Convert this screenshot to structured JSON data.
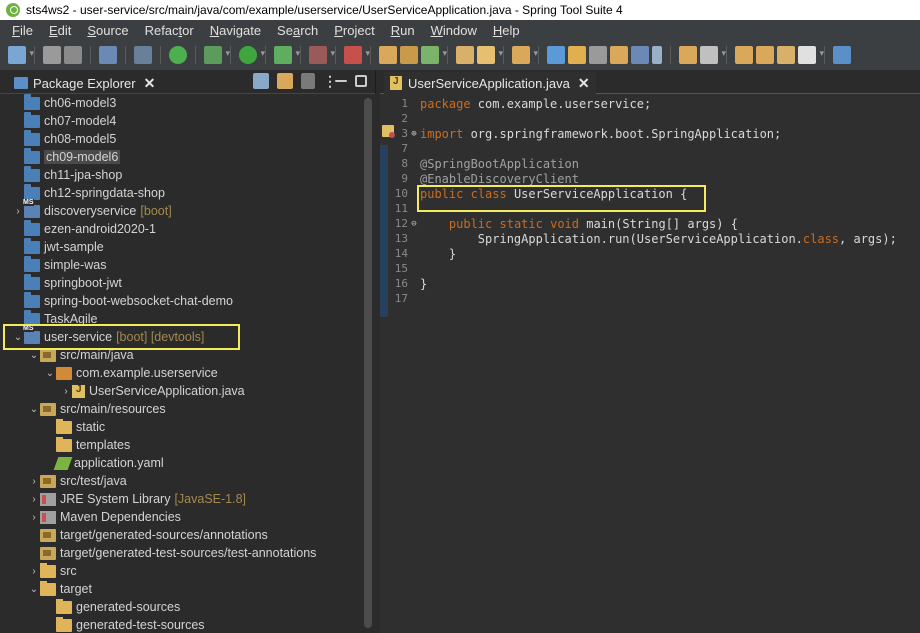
{
  "window": {
    "title": "sts4ws2 - user-service/src/main/java/com/example/userservice/UserServiceApplication.java - Spring Tool Suite 4"
  },
  "menubar": {
    "items": [
      {
        "label": "File",
        "mnemonic": "F"
      },
      {
        "label": "Edit",
        "mnemonic": "E"
      },
      {
        "label": "Source",
        "mnemonic": "S"
      },
      {
        "label": "Refactor",
        "mnemonic": "t"
      },
      {
        "label": "Navigate",
        "mnemonic": "N"
      },
      {
        "label": "Search",
        "mnemonic": "a"
      },
      {
        "label": "Project",
        "mnemonic": "P"
      },
      {
        "label": "Run",
        "mnemonic": "R"
      },
      {
        "label": "Window",
        "mnemonic": "W"
      },
      {
        "label": "Help",
        "mnemonic": "H"
      }
    ]
  },
  "package_explorer": {
    "tab_label": "Package Explorer",
    "close_glyph": "✕",
    "menu_glyph": "⋮",
    "items": [
      {
        "label": "ch06-model3",
        "suffix": "",
        "icon": "project-icon",
        "arrow": ""
      },
      {
        "label": "ch07-model4",
        "suffix": "",
        "icon": "project-icon",
        "arrow": ""
      },
      {
        "label": "ch08-model5",
        "suffix": "",
        "icon": "project-icon",
        "arrow": ""
      },
      {
        "label": "ch09-model6",
        "suffix": "",
        "icon": "project-icon",
        "arrow": ""
      },
      {
        "label": "ch11-jpa-shop",
        "suffix": "",
        "icon": "project-icon",
        "arrow": ""
      },
      {
        "label": "ch12-springdata-shop",
        "suffix": "",
        "icon": "project-icon",
        "arrow": ""
      },
      {
        "label": "discoveryservice",
        "suffix": "[boot]",
        "icon": "boot-project-icon",
        "arrow": "›"
      },
      {
        "label": "ezen-android2020-1",
        "suffix": "",
        "icon": "project-icon",
        "arrow": ""
      },
      {
        "label": "jwt-sample",
        "suffix": "",
        "icon": "project-icon",
        "arrow": ""
      },
      {
        "label": "simple-was",
        "suffix": "",
        "icon": "project-icon",
        "arrow": ""
      },
      {
        "label": "springboot-jwt",
        "suffix": "",
        "icon": "project-icon",
        "arrow": ""
      },
      {
        "label": "spring-boot-websocket-chat-demo",
        "suffix": "",
        "icon": "project-icon",
        "arrow": ""
      },
      {
        "label": "TaskAgile",
        "suffix": "",
        "icon": "project-icon",
        "arrow": ""
      },
      {
        "label": "user-service",
        "suffix": "[boot] [devtools]",
        "icon": "boot-project-icon",
        "arrow": "⌄"
      },
      {
        "label": "src/main/java",
        "suffix": "",
        "icon": "source-folder-icon",
        "arrow": "⌄"
      },
      {
        "label": "com.example.userservice",
        "suffix": "",
        "icon": "package-icon",
        "arrow": "⌄"
      },
      {
        "label": "UserServiceApplication.java",
        "suffix": "",
        "icon": "java-file-icon",
        "arrow": "›"
      },
      {
        "label": "src/main/resources",
        "suffix": "",
        "icon": "source-folder-icon",
        "arrow": "⌄"
      },
      {
        "label": "static",
        "suffix": "",
        "icon": "folder-icon",
        "arrow": ""
      },
      {
        "label": "templates",
        "suffix": "",
        "icon": "folder-icon",
        "arrow": ""
      },
      {
        "label": "application.yaml",
        "suffix": "",
        "icon": "yaml-file-icon",
        "arrow": ""
      },
      {
        "label": "src/test/java",
        "suffix": "",
        "icon": "source-folder-icon",
        "arrow": "›"
      },
      {
        "label": "JRE System Library",
        "suffix": "[JavaSE-1.8]",
        "icon": "library-icon",
        "arrow": "›"
      },
      {
        "label": "Maven Dependencies",
        "suffix": "",
        "icon": "library-icon",
        "arrow": "›"
      },
      {
        "label": "target/generated-sources/annotations",
        "suffix": "",
        "icon": "source-folder-icon",
        "arrow": ""
      },
      {
        "label": "target/generated-test-sources/test-annotations",
        "suffix": "",
        "icon": "source-folder-icon",
        "arrow": ""
      },
      {
        "label": "src",
        "suffix": "",
        "icon": "folder-icon",
        "arrow": "›"
      },
      {
        "label": "target",
        "suffix": "",
        "icon": "folder-icon",
        "arrow": "⌄"
      },
      {
        "label": "generated-sources",
        "suffix": "",
        "icon": "folder-icon",
        "arrow": ""
      },
      {
        "label": "generated-test-sources",
        "suffix": "",
        "icon": "folder-icon",
        "arrow": ""
      }
    ]
  },
  "editor": {
    "tab_label": "UserServiceApplication.java",
    "close_glyph": "✕",
    "lines": [
      {
        "n": "1",
        "marker": "",
        "tokens": [
          {
            "t": "package",
            "c": "kw"
          },
          {
            "t": " com.example.userservice;",
            "c": "dflt"
          }
        ]
      },
      {
        "n": "2",
        "marker": "",
        "tokens": []
      },
      {
        "n": "3",
        "marker": "⊕",
        "tokens": [
          {
            "t": "import",
            "c": "kw"
          },
          {
            "t": " org.springframework.boot.SpringApplication;",
            "c": "dflt"
          }
        ]
      },
      {
        "n": "7",
        "marker": "",
        "tokens": []
      },
      {
        "n": "8",
        "marker": "",
        "tokens": [
          {
            "t": "@SpringBootApplication",
            "c": "ann"
          }
        ]
      },
      {
        "n": "9",
        "marker": "",
        "tokens": [
          {
            "t": "@EnableDiscoveryClient",
            "c": "ann"
          }
        ]
      },
      {
        "n": "10",
        "marker": "",
        "tokens": [
          {
            "t": "public",
            "c": "kw"
          },
          {
            "t": " ",
            "c": "dflt"
          },
          {
            "t": "class",
            "c": "kw"
          },
          {
            "t": " UserServiceApplication {",
            "c": "dflt"
          }
        ]
      },
      {
        "n": "11",
        "marker": "",
        "tokens": []
      },
      {
        "n": "12",
        "marker": "⊖",
        "tokens": [
          {
            "t": "    ",
            "c": "dflt"
          },
          {
            "t": "public",
            "c": "kw"
          },
          {
            "t": " ",
            "c": "dflt"
          },
          {
            "t": "static",
            "c": "kw"
          },
          {
            "t": " ",
            "c": "dflt"
          },
          {
            "t": "void",
            "c": "kw"
          },
          {
            "t": " main(String[] args) {",
            "c": "dflt"
          }
        ]
      },
      {
        "n": "13",
        "marker": "",
        "tokens": [
          {
            "t": "        SpringApplication.run(UserServiceApplication.",
            "c": "dflt"
          },
          {
            "t": "class",
            "c": "kw"
          },
          {
            "t": ", args);",
            "c": "dflt"
          }
        ]
      },
      {
        "n": "14",
        "marker": "",
        "tokens": [
          {
            "t": "    }",
            "c": "dflt"
          }
        ]
      },
      {
        "n": "15",
        "marker": "",
        "tokens": []
      },
      {
        "n": "16",
        "marker": "",
        "tokens": [
          {
            "t": "}",
            "c": "dflt"
          }
        ]
      },
      {
        "n": "17",
        "marker": "",
        "tokens": []
      }
    ]
  },
  "colors": {
    "background": "#2b2b2b",
    "keyword": "#cc6c1d",
    "annotation": "#a0a0a0",
    "highlight": "#f3ea5e",
    "boot_suffix": "#a58a4e"
  }
}
